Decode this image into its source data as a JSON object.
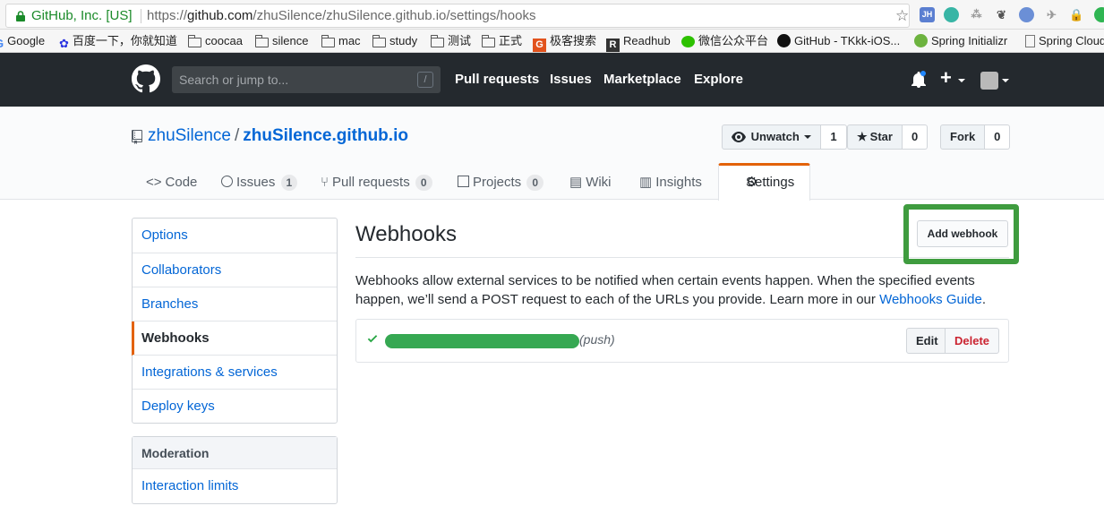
{
  "browser": {
    "secure_label": "GitHub, Inc. [US]",
    "url_prefix": "https://",
    "url_host": "github.com",
    "url_path": "/zhuSilence/zhuSilence.github.io/settings/hooks",
    "bookmarks": [
      "Google",
      "百度一下，你就知道",
      "coocaa",
      "silence",
      "mac",
      "study",
      "测试",
      "正式",
      "极客搜索",
      "Readhub",
      "微信公众平台",
      "GitHub - TKkk-iOS...",
      "Spring Initializr",
      "Spring Cloud"
    ],
    "extension_jh": "JH"
  },
  "header": {
    "search_placeholder": "Search or jump to...",
    "search_key": "/",
    "nav": [
      "Pull requests",
      "Issues",
      "Marketplace",
      "Explore"
    ],
    "plus": "+"
  },
  "repo": {
    "owner": "zhuSilence",
    "separator": "/",
    "name": "zhuSilence.github.io",
    "unwatch_label": "Unwatch",
    "unwatch_count": "1",
    "star_label": "Star",
    "star_count": "0",
    "fork_label": "Fork",
    "fork_count": "0",
    "tabs": [
      {
        "label": "Code",
        "count": ""
      },
      {
        "label": "Issues",
        "count": "1"
      },
      {
        "label": "Pull requests",
        "count": "0"
      },
      {
        "label": "Projects",
        "count": "0"
      },
      {
        "label": "Wiki",
        "count": ""
      },
      {
        "label": "Insights",
        "count": ""
      },
      {
        "label": "Settings",
        "count": ""
      }
    ]
  },
  "sidebar": {
    "items": [
      "Options",
      "Collaborators",
      "Branches",
      "Webhooks",
      "Integrations & services",
      "Deploy keys"
    ],
    "moderation_heading": "Moderation",
    "moderation_items": [
      "Interaction limits"
    ]
  },
  "main": {
    "title": "Webhooks",
    "add_button": "Add webhook",
    "description_1": "Webhooks allow external services to be notified when certain events happen. When the specified events happen, we’ll send a POST request to each of the URLs you provide. Learn more in our ",
    "description_link": "Webhooks Guide",
    "description_end": ".",
    "hook": {
      "event": "(push)",
      "edit": "Edit",
      "delete": "Delete"
    }
  },
  "colors": {
    "accent": "#0366d6",
    "highlight": "#3f9c3f",
    "header_bg": "#24292e",
    "tab_accent": "#e36209",
    "danger": "#cb2431"
  },
  "icons": [
    "lock-icon",
    "bookmark-star-icon",
    "folder-icon",
    "github-logo-icon",
    "bell-icon",
    "repo-icon",
    "eye-icon",
    "star-icon",
    "code-icon",
    "issue-icon",
    "pull-request-icon",
    "project-icon",
    "wiki-icon",
    "graph-icon",
    "gear-icon",
    "check-icon"
  ]
}
